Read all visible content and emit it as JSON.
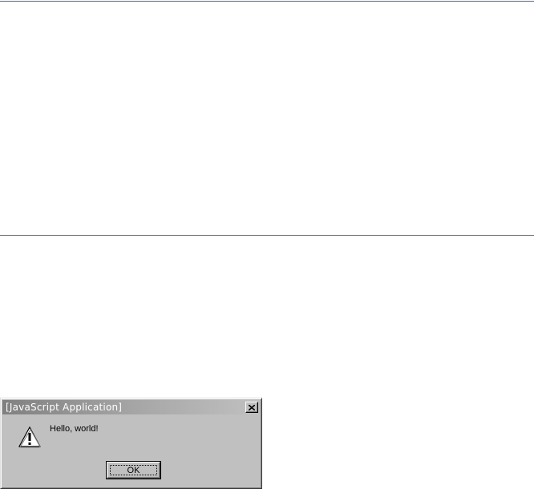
{
  "dialog": {
    "title": "[JavaScript Application]",
    "message": "Hello, world!",
    "ok_label": "OK",
    "icon": "warning-icon",
    "close_icon": "close-icon"
  },
  "colors": {
    "rule": "#2f6fb7",
    "dialog_face": "#c0c0c0",
    "titlebar_start": "#808080"
  }
}
